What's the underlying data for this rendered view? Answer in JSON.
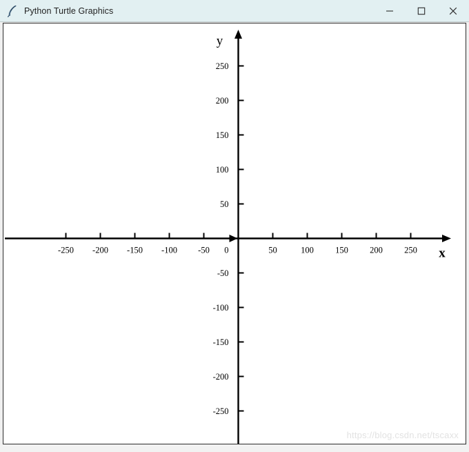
{
  "window": {
    "title": "Python Turtle Graphics",
    "icon": "feather-quill-icon",
    "titlebar_color": "#e2f0f2",
    "controls": {
      "minimize_label": "Minimize",
      "maximize_label": "Maximize",
      "close_label": "Close"
    }
  },
  "watermark": {
    "text": "https://blog.csdn.net/tscaxx",
    "color": "#e2e2e2"
  },
  "chart_data": {
    "type": "line",
    "title": "",
    "subtitle": "",
    "xlabel": "x",
    "ylabel": "y",
    "stroke_color": "#000000",
    "background": "#ffffff",
    "grid": false,
    "legend": null,
    "annotations": [],
    "origin_label": "0",
    "xlim": [
      -300,
      300
    ],
    "ylim": [
      -300,
      300
    ],
    "x_ticks": [
      -250,
      -200,
      -150,
      -100,
      -50,
      50,
      100,
      150,
      200,
      250
    ],
    "x_tick_labels": [
      "-250",
      "-200",
      "-150",
      "-100",
      "-50",
      "50",
      "100",
      "150",
      "200",
      "250"
    ],
    "y_ticks": [
      250,
      200,
      150,
      100,
      50,
      -50,
      -100,
      -150,
      -200,
      -250
    ],
    "y_tick_labels": [
      "250",
      "200",
      "150",
      "100",
      "50",
      "-50",
      "-100",
      "-150",
      "-200",
      "-250"
    ],
    "x_axis_arrow": "right",
    "y_axis_arrow": "up",
    "tick_length": 8,
    "pixels_per_unit": 1.0,
    "series": []
  }
}
